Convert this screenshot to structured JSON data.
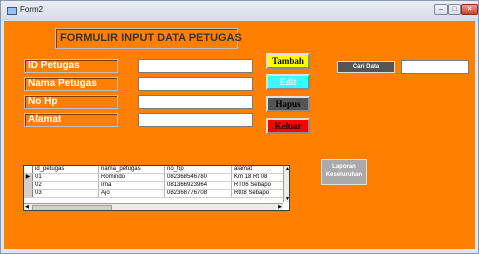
{
  "window": {
    "title": "Form2",
    "minimize": "–",
    "maximize": "□",
    "close": "×"
  },
  "heading": "FORMULIR INPUT DATA PETUGAS",
  "fields": [
    {
      "label": "ID Petugas",
      "value": ""
    },
    {
      "label": "Nama Petugas",
      "value": ""
    },
    {
      "label": "No Hp",
      "value": ""
    },
    {
      "label": "Alamat",
      "value": ""
    }
  ],
  "buttons": {
    "tambah": "Tambah",
    "edit": "Edit",
    "hapus": "Hapus",
    "keluar": "Keluar",
    "cari": "Cari Data",
    "laporan": "Laporan Keseluruhan"
  },
  "search": {
    "value": ""
  },
  "grid": {
    "columns": [
      "id_petugas",
      "nama_petugas",
      "no_hp",
      "alamat"
    ],
    "rows": [
      [
        "01",
        "Romindo",
        "082368546780",
        "Km 18 Rt 08"
      ],
      [
        "02",
        "Irna",
        "081366923964",
        "RT06 Sebapo"
      ],
      [
        "03",
        "Ajo",
        "082368776708",
        "Rt08 Sebapo"
      ]
    ],
    "selected_marker": "▶"
  },
  "colors": {
    "form_background": "#ff8000",
    "tambah": "#ffff00",
    "edit": "#33ffff",
    "hapus": "#555555",
    "keluar": "#ff0000"
  }
}
